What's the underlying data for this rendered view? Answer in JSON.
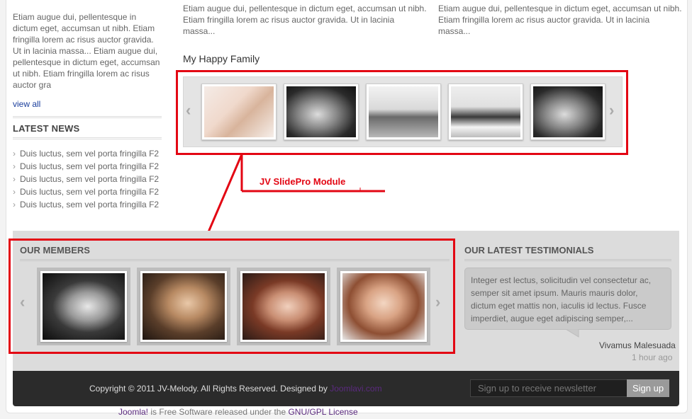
{
  "left_column": {
    "intro_text": "Etiam augue dui, pellentesque in dictum eget, accumsan ut nibh. Etiam fringilla lorem ac risus auctor gravida. Ut in lacinia massa... Etiam augue dui, pellentesque in dictum eget, accumsan ut nibh. Etiam fringilla lorem ac risus auctor gra",
    "view_all": "view all",
    "latest_news_heading": "LATEST NEWS",
    "news_items": [
      "Duis luctus, sem vel porta fringilla F2",
      "Duis luctus, sem vel porta fringilla F2",
      "Duis luctus, sem vel porta fringilla F2",
      "Duis luctus, sem vel porta fringilla F2",
      "Duis luctus, sem vel porta fringilla F2"
    ]
  },
  "top_texts": {
    "col1": "Etiam augue dui, pellentesque in dictum eget, accumsan ut nibh. Etiam fringilla lorem ac risus auctor gravida. Ut in lacinia massa...",
    "col2": "Etiam augue dui, pellentesque in dictum eget, accumsan ut nibh. Etiam fringilla lorem ac risus auctor gravida. Ut in lacinia massa..."
  },
  "family_slider": {
    "title": "My Happy Family",
    "prev_arrow": "‹",
    "next_arrow": "›"
  },
  "annotation": {
    "label": "JV SlidePro Module",
    "color": "#e30613"
  },
  "members": {
    "heading": "OUR MEMBERS",
    "prev_arrow": "‹",
    "next_arrow": "›"
  },
  "testimonials": {
    "heading": "OUR LATEST TESTIMONIALS",
    "quote": "Integer est lectus, solicitudin vel consectetur ac, semper sit amet ipsum. Mauris mauris dolor, dictum eget mattis non, iaculis id lectus. Fusce imperdiet, augue eget adipiscing semper,...",
    "author": "Vivamus Malesuada",
    "time": "1 hour ago"
  },
  "footer": {
    "copyright": "Copyright © 2011 JV-Melody. All Rights Reserved. Designed by",
    "designer_link": "Joomlavi.com",
    "newsletter_placeholder": "Sign up to receive newsletter",
    "signup_button": "Sign up",
    "bottom_brand": "Joomla!",
    "bottom_text": " is Free Software released under the ",
    "bottom_license": "GNU/GPL License"
  },
  "colors": {
    "accent_red": "#e30613",
    "footer_bg": "#2b2b2b",
    "band_bg": "#dcdcdc"
  }
}
